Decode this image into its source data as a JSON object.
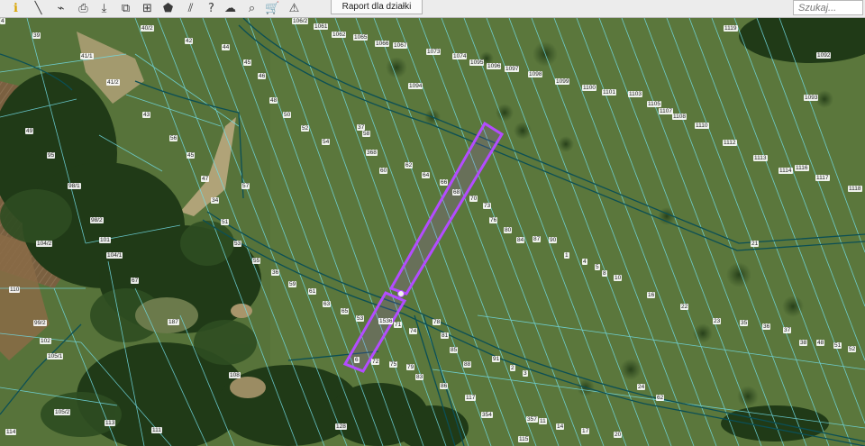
{
  "toolbar": {
    "tools": [
      {
        "icon": "info-icon",
        "glyph": "ℹ",
        "color": "#d9a400"
      },
      {
        "icon": "measure-distance-icon",
        "glyph": "╲"
      },
      {
        "icon": "link-icon",
        "glyph": "⌁"
      },
      {
        "icon": "print-icon",
        "glyph": "⎙"
      },
      {
        "icon": "download-icon",
        "glyph": "⤓"
      },
      {
        "icon": "export-icon",
        "glyph": "⧉"
      },
      {
        "icon": "layers-grid-icon",
        "glyph": "⊞"
      },
      {
        "icon": "shape-icon",
        "glyph": "⬟"
      },
      {
        "icon": "hatch-icon",
        "glyph": "⫽"
      },
      {
        "icon": "help-icon",
        "glyph": "?"
      },
      {
        "icon": "cloud-upload-icon",
        "glyph": "☁"
      },
      {
        "icon": "zoom-search-icon",
        "glyph": "⌕"
      },
      {
        "icon": "cart-icon",
        "glyph": "🛒"
      },
      {
        "icon": "warning-icon",
        "glyph": "⚠"
      }
    ],
    "report_button": "Raport dla działki",
    "search_placeholder": "Szukaj..."
  },
  "map": {
    "colors": {
      "parcel_line": "#72dce6",
      "road_line": "#0b4f55",
      "highlight": "#b34cff"
    },
    "labels": [
      "39",
      "40/2",
      "42",
      "41/1",
      "41/2",
      "44",
      "45",
      "46",
      "43",
      "48",
      "50",
      "52",
      "54",
      "56",
      "45",
      "47",
      "49",
      "95",
      "98/1",
      "98/2",
      "101",
      "104/1",
      "104/2",
      "34",
      "51",
      "53",
      "55",
      "57",
      "36",
      "59",
      "61",
      "63",
      "65",
      "67",
      "187",
      "110",
      "99/2",
      "102",
      "105/1",
      "105/2",
      "108",
      "113",
      "111",
      "114",
      "106/2",
      "1061",
      "1062",
      "1065",
      "1066",
      "1067",
      "1073",
      "1074",
      "1095",
      "1096",
      "1097",
      "1098",
      "1099",
      "1100",
      "1101",
      "1103",
      "1105",
      "1107",
      "1108",
      "1110",
      "1112",
      "1113",
      "1114",
      "1116",
      "1117",
      "1118",
      "1119",
      "1092",
      "1093",
      "1094",
      "37",
      "58",
      "368",
      "60",
      "62",
      "64",
      "66",
      "68",
      "70",
      "73",
      "76",
      "80",
      "84",
      "87",
      "90",
      "1",
      "4",
      "5",
      "8",
      "10",
      "16",
      "21",
      "22",
      "23",
      "35",
      "36",
      "37",
      "38",
      "48",
      "51",
      "52",
      "53",
      "1536",
      "71",
      "74",
      "78",
      "81",
      "85",
      "88",
      "91",
      "2",
      "3",
      "6",
      "72",
      "75",
      "79",
      "83",
      "86",
      "117",
      "354",
      "357",
      "11",
      "14",
      "17",
      "20",
      "24",
      "62",
      "128",
      "115",
      "4"
    ]
  }
}
